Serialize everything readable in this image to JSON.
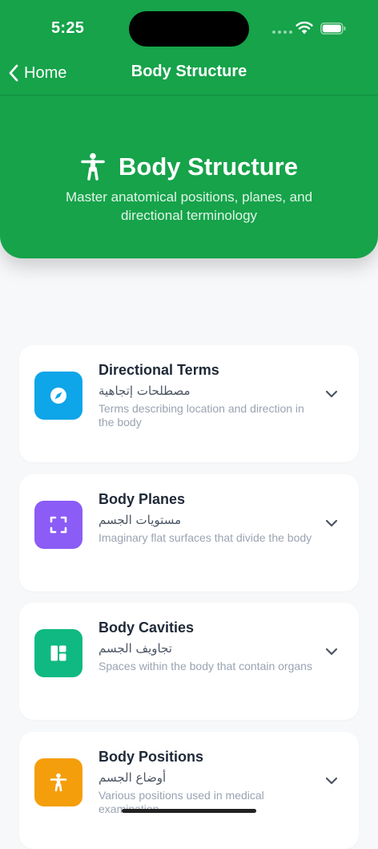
{
  "status_bar": {
    "time": "5:25"
  },
  "nav": {
    "back_label": "Home",
    "title": "Body Structure"
  },
  "hero": {
    "title": "Body Structure",
    "subtitle": "Master anatomical positions, planes, and directional terminology",
    "icon": "person-standing-icon"
  },
  "colors": {
    "header_green": "#16a34a",
    "directional": "#0ea5e9",
    "planes": "#8b5cf6",
    "cavities": "#10b981",
    "positions": "#f59e0b"
  },
  "topics": [
    {
      "title": "Directional Terms",
      "arabic": "مصطلحات إتجاهية",
      "description": "Terms describing location and direction in the body",
      "icon": "compass-icon"
    },
    {
      "title": "Body Planes",
      "arabic": "مستويات الجسم",
      "description": "Imaginary flat surfaces that divide the body",
      "icon": "scan-frame-icon"
    },
    {
      "title": "Body Cavities",
      "arabic": "تجاويف الجسم",
      "description": "Spaces within the body that contain organs",
      "icon": "layout-grid-icon"
    },
    {
      "title": "Body Positions",
      "arabic": "أوضاع الجسم",
      "description": "Various positions used in medical examination",
      "icon": "person-standing-icon"
    }
  ]
}
